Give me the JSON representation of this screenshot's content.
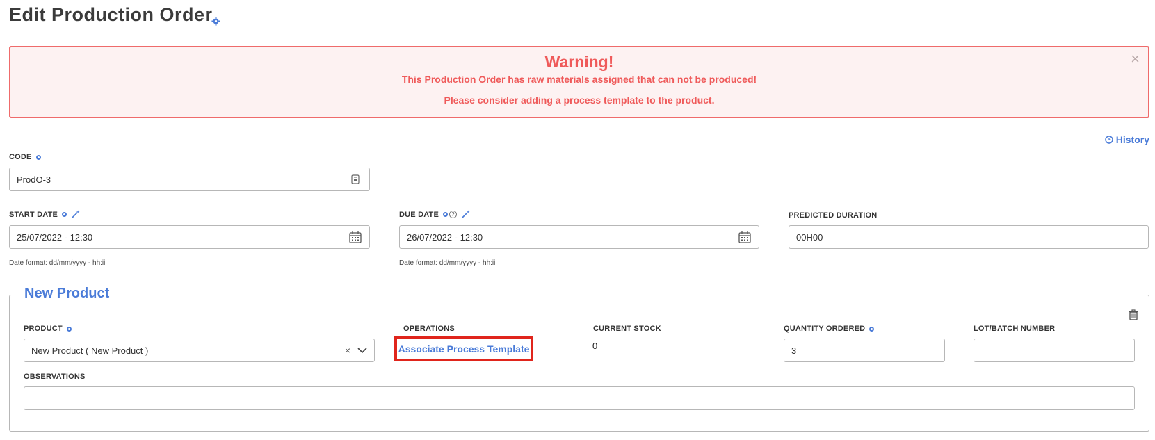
{
  "header": {
    "title": "Edit Production Order"
  },
  "alert": {
    "title": "Warning!",
    "line1": "This Production Order has raw materials assigned that can not be produced!",
    "line2": "Please consider adding a process template to the product.",
    "close_icon": "×"
  },
  "history": {
    "label": "History"
  },
  "code": {
    "label": "Code",
    "value": "ProdO-3"
  },
  "start_date": {
    "label": "Start Date",
    "value": "25/07/2022 - 12:30",
    "hint": "Date format: dd/mm/yyyy - hh:ii"
  },
  "due_date": {
    "label": "Due Date",
    "value": "26/07/2022 - 12:30",
    "hint": "Date format: dd/mm/yyyy - hh:ii"
  },
  "predicted_duration": {
    "label": "Predicted Duration",
    "value": "00H00"
  },
  "product_section": {
    "legend": "New Product",
    "product": {
      "label": "Product",
      "value": "New Product ( New Product )",
      "clear_icon": "×"
    },
    "operations": {
      "label": "Operations",
      "link": "Associate Process Template"
    },
    "current_stock": {
      "label": "Current Stock",
      "value": "0"
    },
    "quantity_ordered": {
      "label": "Quantity Ordered",
      "value": "3"
    },
    "lot_batch": {
      "label": "Lot/Batch Number",
      "value": ""
    },
    "observations": {
      "label": "Observations",
      "value": ""
    }
  },
  "colors": {
    "accent": "#4a7bd8",
    "warning": "#ef5a5a",
    "highlight": "#e0251c"
  }
}
